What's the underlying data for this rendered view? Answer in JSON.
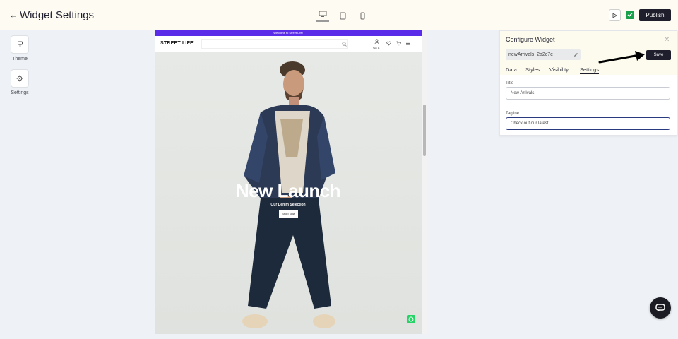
{
  "header": {
    "back_icon": "arrow-left-icon",
    "title": "Widget Settings",
    "devices": [
      "desktop-icon",
      "tablet-icon",
      "mobile-icon"
    ],
    "active_device": "desktop",
    "preview_icon": "play-icon",
    "status_icon": "check-icon",
    "publish_label": "Publish"
  },
  "sidebar": {
    "items": [
      {
        "label": "Theme",
        "icon": "brush-icon"
      },
      {
        "label": "Settings",
        "icon": "gear-icon"
      }
    ]
  },
  "preview": {
    "announcement": "Welcome to Street Life!",
    "logo": "STREET LIFE",
    "signin_label": "Sign In",
    "hero_title": "New Launch",
    "hero_subtitle": "Our Denim Selection",
    "hero_button": "Shop Now",
    "accent_color": "#5b2bea"
  },
  "panel": {
    "title": "Configure Widget",
    "widget_id": "newArrivals_2a2c7e",
    "save_label": "Save",
    "tabs": [
      {
        "label": "Data"
      },
      {
        "label": "Styles"
      },
      {
        "label": "Visibility"
      },
      {
        "label": "Settings"
      }
    ],
    "active_tab": "Settings",
    "fields": {
      "title": {
        "label": "Title",
        "value": "New Arrivals"
      },
      "tagline": {
        "label": "Tagline",
        "value": "Check out our latest"
      }
    }
  }
}
